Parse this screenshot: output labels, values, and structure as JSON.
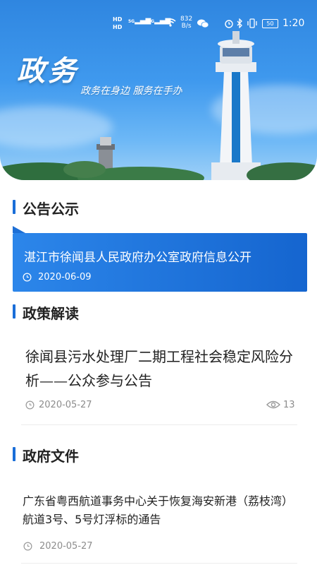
{
  "status_bar": {
    "hd1": "HD",
    "hd2": "HD",
    "net1": "5G",
    "net2": "4G",
    "speed_value": "832",
    "speed_unit": "B/s",
    "battery": "50",
    "time": "1:20"
  },
  "hero": {
    "title": "政务",
    "subtitle": "政务在身边 服务在手办"
  },
  "sections": {
    "announcements": "公告公示",
    "policy": "政策解读",
    "documents": "政府文件"
  },
  "announcement": {
    "headline": "湛江市徐闻县人民政府办公室政府信息公开",
    "date": "2020-06-09"
  },
  "policy_item": {
    "title": "徐闻县污水处理厂二期工程社会稳定风险分析——公众参与公告",
    "date": "2020-05-27",
    "views": "13"
  },
  "document_item": {
    "title": "广东省粤西航道事务中心关于恢复海安新港（荔枝湾）航道3号、5号灯浮标的通告",
    "date": "2020-05-27"
  },
  "colors": {
    "accent": "#1a6ed8",
    "card_gradient_start": "#2c86ea",
    "card_gradient_end": "#1565cf",
    "meta_text": "#8c8c8c"
  },
  "icons": [
    "clock-icon",
    "eye-icon",
    "wifi-icon",
    "signal-icon",
    "alarm-icon",
    "bluetooth-icon",
    "vibrate-icon",
    "wechat-icon"
  ]
}
